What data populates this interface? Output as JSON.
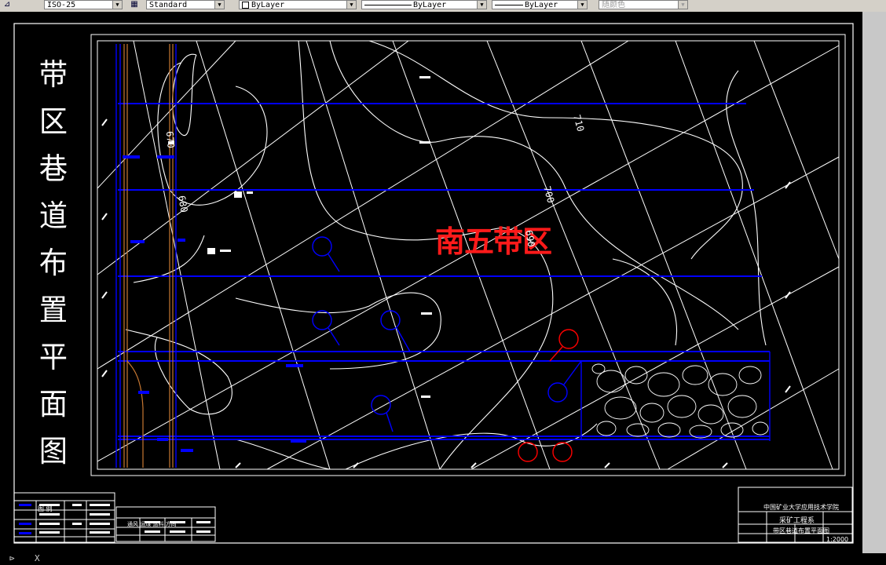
{
  "toolbar": {
    "dimstyle": "ISO-25",
    "textstyle": "Standard",
    "layer_color": "ByLayer",
    "linetype": "ByLayer",
    "lineweight": "ByLayer",
    "plotstyle": "随颜色"
  },
  "drawing": {
    "vertical_title": [
      "带",
      "区",
      "巷",
      "道",
      "布",
      "置",
      "平",
      "面",
      "图"
    ],
    "zone_label": "南五带区",
    "contour_labels": [
      "710",
      "700",
      "690",
      "680",
      "670",
      "710"
    ],
    "title_block": {
      "school": "中国矿业大学应用技术学院",
      "course": "采矿工程系",
      "drawing_name": "带区巷道布置平面图",
      "scale": "1:2000"
    },
    "legend_caption": "图 例",
    "direction_caption": "通风 运煤 运料 方向"
  },
  "command_line": {
    "prompt": "X"
  },
  "colors": {
    "background": "#000000",
    "contour": "#ffffff",
    "roadway": "#0000ff",
    "highlight": "#ff0000",
    "orange": "#c87832"
  }
}
